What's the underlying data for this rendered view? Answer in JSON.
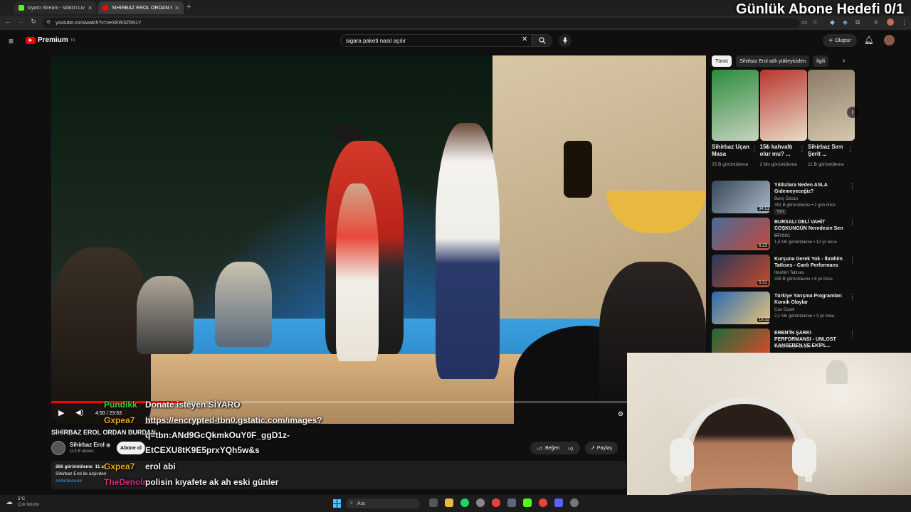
{
  "overlay": {
    "goal_text": "Günlük Abone Hedefi 0/1"
  },
  "browser": {
    "tabs": [
      {
        "title": "siyaro Stream - Watch Live on K",
        "favicon_color": "#53fc18"
      },
      {
        "title": "SİHİRBAZ EROL ORDAN BURDAN",
        "favicon_color": "#ff0000"
      }
    ],
    "url": "youtube.com/watch?v=veXEW3Z5N1Y"
  },
  "youtube": {
    "logo_text": "Premium",
    "logo_region": "TR",
    "search_value": "sigara paketi nasıl açılır",
    "create_label": "Oluştur"
  },
  "video": {
    "time": "4:50 / 23:53",
    "progress": 0.2027,
    "title": "SİHİRBAZ EROL ORDAN BURDAN",
    "channel": "Sihirbaz Erol",
    "subscribers": "113 B abone",
    "subscribe_label": "Abone ol",
    "like_label": "Beğen",
    "share_label": "Paylaş",
    "views": "266 görüntüleme",
    "date": "11 ay",
    "desc_line": "Sihirbaz Erol ile arşivden",
    "hashtags": "#sihirbazerol"
  },
  "chat": [
    {
      "user": "Pundikk",
      "user_color": "#3ad23a",
      "message": "Donate isteyen SİYARO"
    },
    {
      "user": "Gxpea7",
      "user_color": "#e6a817",
      "message": "https://encrypted-tbn0.gstatic.com/images?"
    },
    {
      "user": "",
      "user_color": "#e6a817",
      "message": "q=tbn:ANd9GcQkmkOuY0F_ggD1z-"
    },
    {
      "user": "",
      "user_color": "#e6a817",
      "message": "EtCEXU8tK9E5prxYQh5w&s"
    },
    {
      "user": "Gxpea7",
      "user_color": "#e6a817",
      "message": "erol abi"
    },
    {
      "user": "TheDenolman",
      "user_color": "#d42e7a",
      "message": "polisin kıyafete ak ah eski günler"
    }
  ],
  "sidebar": {
    "chips": [
      "Tümü",
      "Sihirbaz Erol adlı yükleyiciden",
      "İlgili"
    ],
    "shorts": [
      {
        "title": "Sihirbaz Uçan Masa",
        "views": "25 B görüntüleme",
        "colors": [
          "#2a8c3a",
          "#c7d2c0"
        ]
      },
      {
        "title": "15₺ kahvaltı olur mu? ...",
        "views": "2 Mn görüntüleme",
        "colors": [
          "#b8362d",
          "#e8dcc6"
        ]
      },
      {
        "title": "Sihirbaz Sırrı Şerit ...",
        "views": "11 B görüntüleme",
        "colors": [
          "#8a7a66",
          "#d6c8b0"
        ]
      }
    ],
    "recommended": [
      {
        "title": "Yıldızlara Neden ASLA Gidemeyeceğiz?",
        "channel": "Barış Özcan",
        "meta": "491 B görüntüleme • 2 gün önce",
        "badge": "Yeni",
        "duration": "34:51",
        "colors": [
          "#39485a",
          "#a8b6c4"
        ]
      },
      {
        "title": "BURSALI DELİ VAHİT COŞKUNGÜN Neredesin Sen ...",
        "channel": "ETHNIC",
        "meta": "1,5 Mn görüntüleme • 12 yıl önce",
        "badge": "",
        "duration": "6:23",
        "colors": [
          "#4a6a9a",
          "#c24a3a"
        ]
      },
      {
        "title": "Kurşuna Gerek Yok - İbrahim Tatlıses - Canlı Performans",
        "channel": "İbrahim Tatlıses",
        "meta": "339 B görüntüleme • 8 yıl önce",
        "badge": "",
        "duration": "5:31",
        "colors": [
          "#2b3a5a",
          "#c44a2a"
        ]
      },
      {
        "title": "Türkiye Yarışma Programları Komik Olaylar",
        "channel": "Can Guzel",
        "meta": "2,1 Mn görüntüleme • 3 yıl önce",
        "badge": "",
        "duration": "18:32",
        "colors": [
          "#2a6ab0",
          "#e8c27a"
        ]
      },
      {
        "title": "EREN'İN ŞARKI PERFORMANSI - UNLOST KANSEREN VE EKİPL...",
        "channel": "Twitch Seyir Defteri",
        "meta": "",
        "badge": "",
        "duration": "",
        "colors": [
          "#1e6b3a",
          "#d94a2a"
        ]
      }
    ]
  },
  "taskbar": {
    "weather_temp": "5°C",
    "weather_desc": "Çok bulutlu",
    "search_label": "Ara"
  }
}
